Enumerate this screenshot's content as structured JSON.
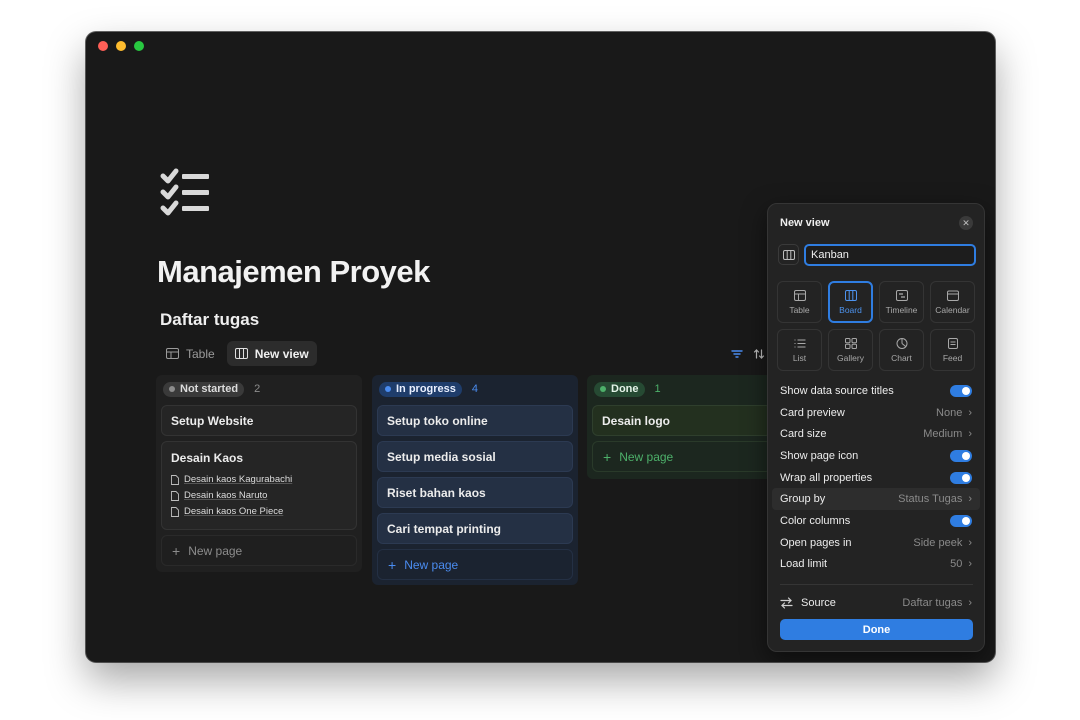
{
  "page": {
    "title": "Manajemen Proyek",
    "icon": "checklist-icon"
  },
  "database": {
    "title": "Daftar tugas"
  },
  "tabs": [
    {
      "label": "Table",
      "icon": "table-icon"
    },
    {
      "label": "New view",
      "icon": "board-icon",
      "active": true
    }
  ],
  "toolbar": {
    "filter_icon": "filter-icon",
    "sort_icon": "sort-icon"
  },
  "board": {
    "columns": [
      {
        "status": "Not started",
        "count": "2",
        "cards": [
          {
            "title": "Setup Website"
          },
          {
            "title": "Desain Kaos",
            "subitems": [
              "Desain kaos Kagurabachi",
              "Desain kaos Naruto",
              "Desain kaos One Piece"
            ]
          }
        ],
        "new_page": "New page"
      },
      {
        "status": "In progress",
        "count": "4",
        "cards": [
          {
            "title": "Setup toko online"
          },
          {
            "title": "Setup media sosial"
          },
          {
            "title": "Riset bahan kaos"
          },
          {
            "title": "Cari tempat printing"
          }
        ],
        "new_page": "New page"
      },
      {
        "status": "Done",
        "count": "1",
        "cards": [
          {
            "title": "Desain logo"
          }
        ],
        "new_page": "New page"
      }
    ]
  },
  "panel": {
    "title": "New view",
    "name_value": "Kanban",
    "layouts": [
      {
        "label": "Table",
        "icon": "table-icon"
      },
      {
        "label": "Board",
        "icon": "board-icon",
        "selected": true
      },
      {
        "label": "Timeline",
        "icon": "timeline-icon"
      },
      {
        "label": "Calendar",
        "icon": "calendar-icon"
      },
      {
        "label": "List",
        "icon": "list-icon"
      },
      {
        "label": "Gallery",
        "icon": "gallery-icon"
      },
      {
        "label": "Chart",
        "icon": "chart-icon"
      },
      {
        "label": "Feed",
        "icon": "feed-icon"
      }
    ],
    "settings": {
      "show_titles": {
        "label": "Show data source titles",
        "on": true
      },
      "card_preview": {
        "label": "Card preview",
        "value": "None"
      },
      "card_size": {
        "label": "Card size",
        "value": "Medium"
      },
      "show_icon": {
        "label": "Show page icon",
        "on": true
      },
      "wrap": {
        "label": "Wrap all properties",
        "on": true
      },
      "group_by": {
        "label": "Group by",
        "value": "Status Tugas"
      },
      "color_columns": {
        "label": "Color columns",
        "on": true
      },
      "open_pages": {
        "label": "Open pages in",
        "value": "Side peek"
      },
      "load_limit": {
        "label": "Load limit",
        "value": "50"
      }
    },
    "source": {
      "label": "Source",
      "value": "Daftar tugas"
    },
    "done_label": "Done"
  },
  "colors": {
    "accent": "#2f7de1",
    "in_progress": "#4a8cf0",
    "done": "#4db06a",
    "window_bg": "#191919"
  }
}
